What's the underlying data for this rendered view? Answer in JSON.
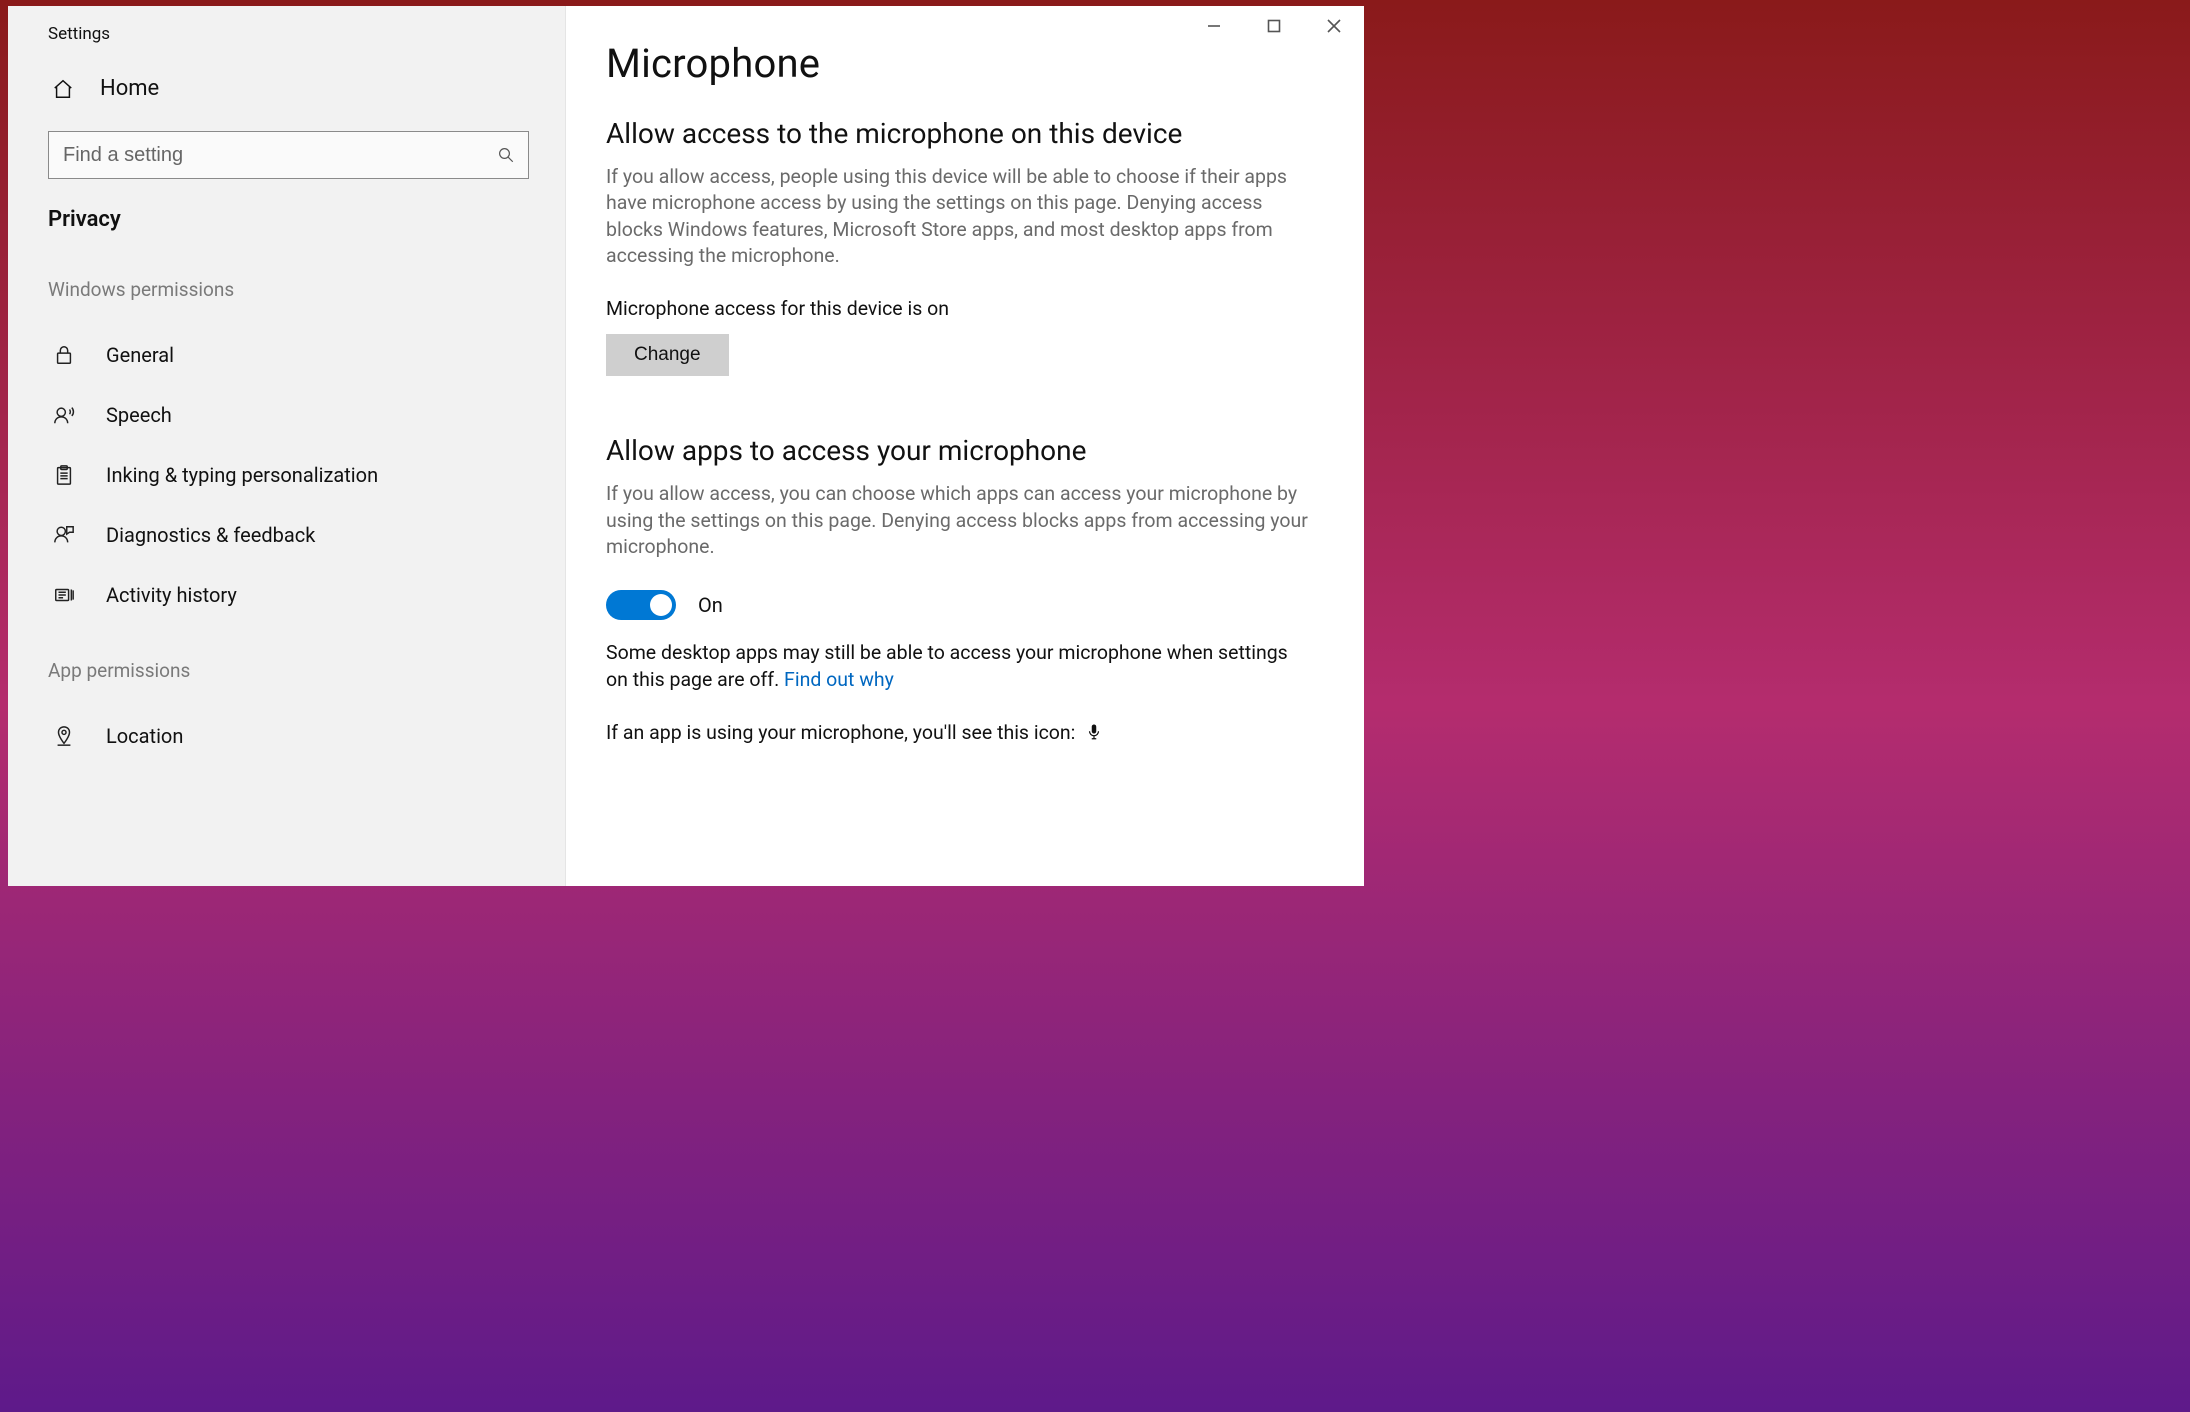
{
  "window": {
    "title": "Settings"
  },
  "sidebar": {
    "home_label": "Home",
    "search_placeholder": "Find a setting",
    "category": "Privacy",
    "groups": [
      {
        "label": "Windows permissions",
        "items": [
          {
            "icon": "lock-icon",
            "label": "General"
          },
          {
            "icon": "speech-icon",
            "label": "Speech"
          },
          {
            "icon": "clipboard-icon",
            "label": "Inking & typing personalization"
          },
          {
            "icon": "feedback-icon",
            "label": "Diagnostics & feedback"
          },
          {
            "icon": "history-icon",
            "label": "Activity history"
          }
        ]
      },
      {
        "label": "App permissions",
        "items": [
          {
            "icon": "location-icon",
            "label": "Location"
          }
        ]
      }
    ]
  },
  "main": {
    "title": "Microphone",
    "section1": {
      "heading": "Allow access to the microphone on this device",
      "body": "If you allow access, people using this device will be able to choose if their apps have microphone access by using the settings on this page. Denying access blocks Windows features, Microsoft Store apps, and most desktop apps from accessing the microphone.",
      "status": "Microphone access for this device is on",
      "change_label": "Change"
    },
    "section2": {
      "heading": "Allow apps to access your microphone",
      "body": "If you allow access, you can choose which apps can access your microphone by using the settings on this page. Denying access blocks apps from accessing your microphone.",
      "toggle_state": "On",
      "note_prefix": "Some desktop apps may still be able to access your microphone when settings on this page are off. ",
      "note_link": "Find out why",
      "icon_line": "If an app is using your microphone, you'll see this icon:"
    }
  }
}
